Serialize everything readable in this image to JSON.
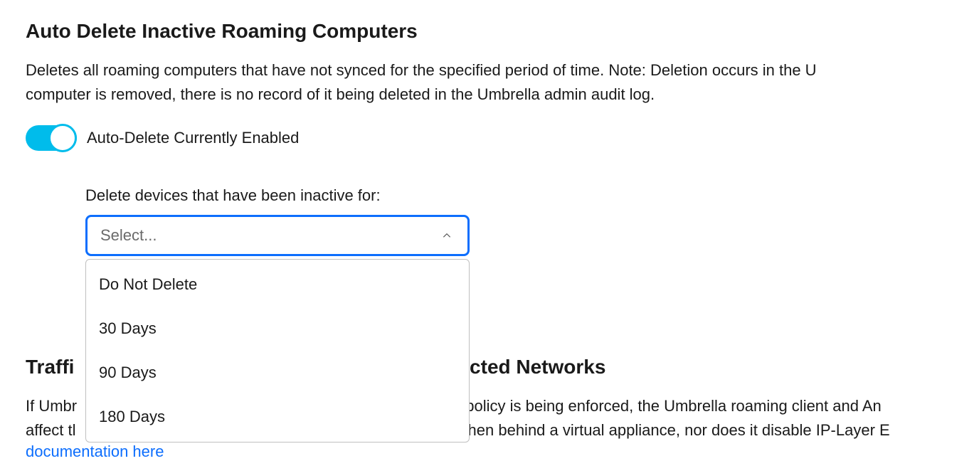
{
  "section1": {
    "title": "Auto Delete Inactive Roaming Computers",
    "description_line1": "Deletes all roaming computers that have not synced for the specified period of time. Note: Deletion occurs in the U",
    "description_line2": "computer is removed, there is no record of it being deleted in the Umbrella admin audit log.",
    "toggle_label": "Auto-Delete Currently Enabled",
    "toggle_state": "on",
    "select_label": "Delete devices that have been inactive for:",
    "select_placeholder": "Select...",
    "options": [
      "Do Not Delete",
      "30 Days",
      "90 Days",
      "180 Days"
    ]
  },
  "section2": {
    "title_left": "Traffi",
    "title_right": "ected Networks",
    "desc_line1_left": "If Umbr",
    "desc_line1_right": " policy is being enforced, the Umbrella roaming client and An",
    "desc_line2_left": "affect tl",
    "desc_line2_right": "vhen behind a virtual appliance, nor does it disable IP-Layer E",
    "doc_link_text": "documentation here"
  }
}
